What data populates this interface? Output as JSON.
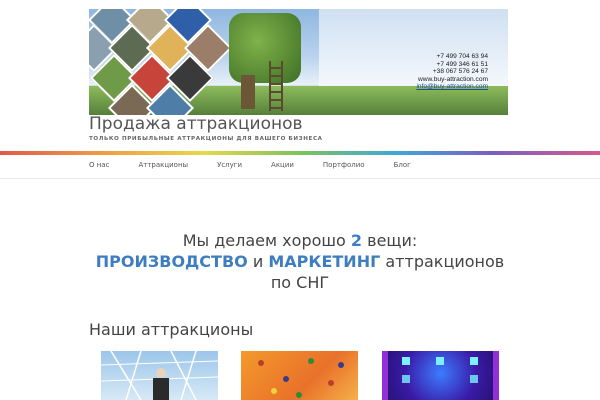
{
  "banner": {
    "contacts": {
      "phone1": "+7 499 704 63 94",
      "phone2": "+7 499 346 61 51",
      "phone3": "+38 067 576 24 67",
      "website": "www.buy-attraction.com",
      "email": "info@buy-attraction.com"
    }
  },
  "site": {
    "title": "Продажа аттракционов",
    "description": "ТОЛЬКО ПРИБЫЛЬНЫЕ АТТРАКЦИОНЫ ДЛЯ ВАШЕГО БИЗНЕСА"
  },
  "nav": {
    "items": [
      {
        "label": "О нас"
      },
      {
        "label": "Аттракционы"
      },
      {
        "label": "Услуги"
      },
      {
        "label": "Акции"
      },
      {
        "label": "Портфолио"
      },
      {
        "label": "Блог"
      }
    ]
  },
  "hero": {
    "line1_prefix": "Мы делаем хорошо ",
    "line1_number": "2",
    "line1_suffix": " вещи:",
    "production": "ПРОИЗВОДСТВО",
    "conjunction": " и ",
    "marketing": "МАРКЕТИНГ",
    "line2_suffix": " аттракционов",
    "line3": "по СНГ"
  },
  "section": {
    "title": "Наши аттракционы"
  },
  "colors": {
    "accent_blue": "#3d7dc0",
    "text": "#444444"
  }
}
